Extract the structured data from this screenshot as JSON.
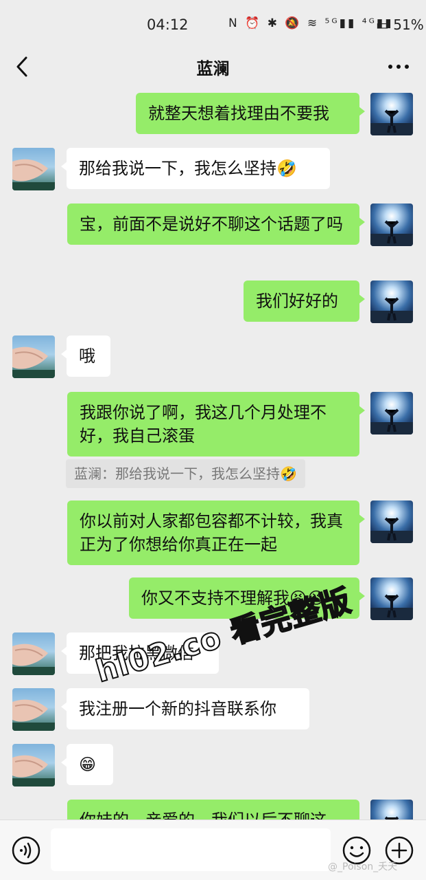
{
  "status_bar": {
    "time": "04:12",
    "icons": "N ⏰ ✱ 🔕 ≋ ⁵ᴳ▮▮ ⁴ᴳ▮▮",
    "battery": "▭ 51%"
  },
  "header": {
    "title": "蓝澜",
    "back_icon": "chevron-left-icon",
    "more_icon": "more-dots-icon"
  },
  "messages": [
    {
      "side": "me",
      "text": "就整天想着找理由不要我"
    },
    {
      "side": "them",
      "text": "那给我说一下，我怎么坚持",
      "emoji": "🤣"
    },
    {
      "side": "me",
      "text": "宝，前面不是说好不聊这个话题了吗"
    },
    {
      "side": "me",
      "text": "我们好好的"
    },
    {
      "side": "them",
      "text": "哦"
    },
    {
      "side": "me",
      "text": "我跟你说了啊，我这几个月处理不好，我自己滚蛋"
    },
    {
      "side": "quote",
      "text": "蓝澜：那给我说一下，我怎么坚持",
      "emoji": "🤣"
    },
    {
      "side": "me",
      "text": "你以前对人家都包容都不计较，我真正为了你想给你真正在一起"
    },
    {
      "side": "me",
      "text": "你又不支持不理解我",
      "emoji": "😫😭"
    },
    {
      "side": "them",
      "text": "那把我拉黑微信"
    },
    {
      "side": "them",
      "text": "我注册一个新的抖音联系你"
    },
    {
      "side": "them",
      "text": "",
      "emoji": "😁"
    },
    {
      "side": "me",
      "text": "你妹的，亲爱的，我们以后不聊这"
    }
  ],
  "watermark": "hl02.co 看完整版",
  "input_bar": {
    "voice_icon": "voice-icon",
    "emoji_icon": "smiley-icon",
    "plus_icon": "plus-icon",
    "input_value": ""
  },
  "source_mark": "@_Poison_夭夭",
  "colors": {
    "background": "#ededed",
    "my_bubble": "#95ec69",
    "their_bubble": "#ffffff",
    "quote_bg": "#e2e2e2"
  }
}
